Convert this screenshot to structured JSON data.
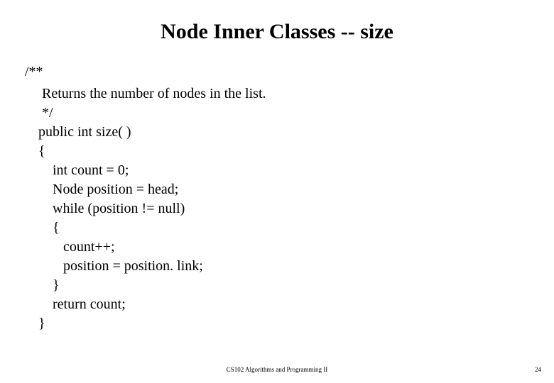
{
  "title": "Node Inner Classes -- size",
  "commentOpen": "/**",
  "code": {
    "l0": " Returns the number of nodes in the list.",
    "l1": " */",
    "l2": "public int size( )",
    "l3": "{",
    "l4": "    int count = 0;",
    "l5": "    Node position = head;",
    "l6": "    while (position != null)",
    "l7": "    {",
    "l8": "       count++;",
    "l9": "       position = position. link;",
    "l10": "    }",
    "l11": "    return count;",
    "l12": "}"
  },
  "footer": "CS102 Algorithms and Programming II",
  "pageNumber": "24"
}
